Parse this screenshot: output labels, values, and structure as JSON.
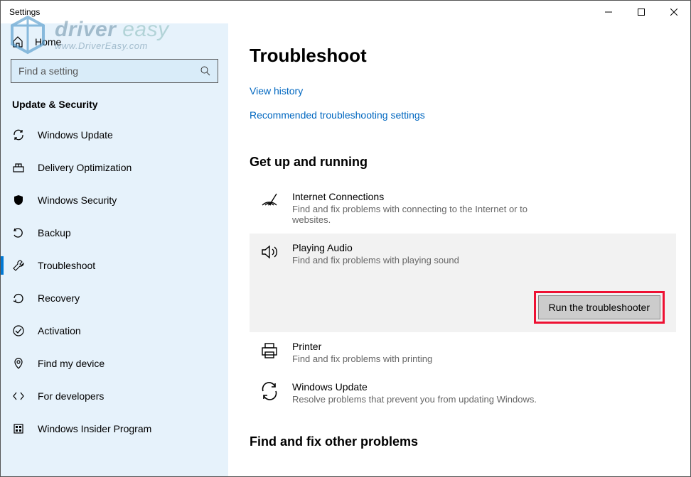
{
  "window": {
    "title": "Settings"
  },
  "sidebar": {
    "home": "Home",
    "search_placeholder": "Find a setting",
    "section": "Update & Security",
    "items": [
      {
        "label": "Windows Update",
        "selected": false
      },
      {
        "label": "Delivery Optimization",
        "selected": false
      },
      {
        "label": "Windows Security",
        "selected": false
      },
      {
        "label": "Backup",
        "selected": false
      },
      {
        "label": "Troubleshoot",
        "selected": true
      },
      {
        "label": "Recovery",
        "selected": false
      },
      {
        "label": "Activation",
        "selected": false
      },
      {
        "label": "Find my device",
        "selected": false
      },
      {
        "label": "For developers",
        "selected": false
      },
      {
        "label": "Windows Insider Program",
        "selected": false
      }
    ]
  },
  "main": {
    "title": "Troubleshoot",
    "links": [
      "View history",
      "Recommended troubleshooting settings"
    ],
    "section1": "Get up and running",
    "troubleshooters": [
      {
        "title": "Internet Connections",
        "desc": "Find and fix problems with connecting to the Internet or to websites.",
        "selected": false
      },
      {
        "title": "Playing Audio",
        "desc": "Find and fix problems with playing sound",
        "selected": true
      },
      {
        "title": "Printer",
        "desc": "Find and fix problems with printing",
        "selected": false
      },
      {
        "title": "Windows Update",
        "desc": "Resolve problems that prevent you from updating Windows.",
        "selected": false
      }
    ],
    "run_button": "Run the troubleshooter",
    "section2": "Find and fix other problems"
  },
  "watermark": {
    "line1a": "driver",
    "line1b": " easy",
    "line2": "www.DriverEasy.com"
  }
}
